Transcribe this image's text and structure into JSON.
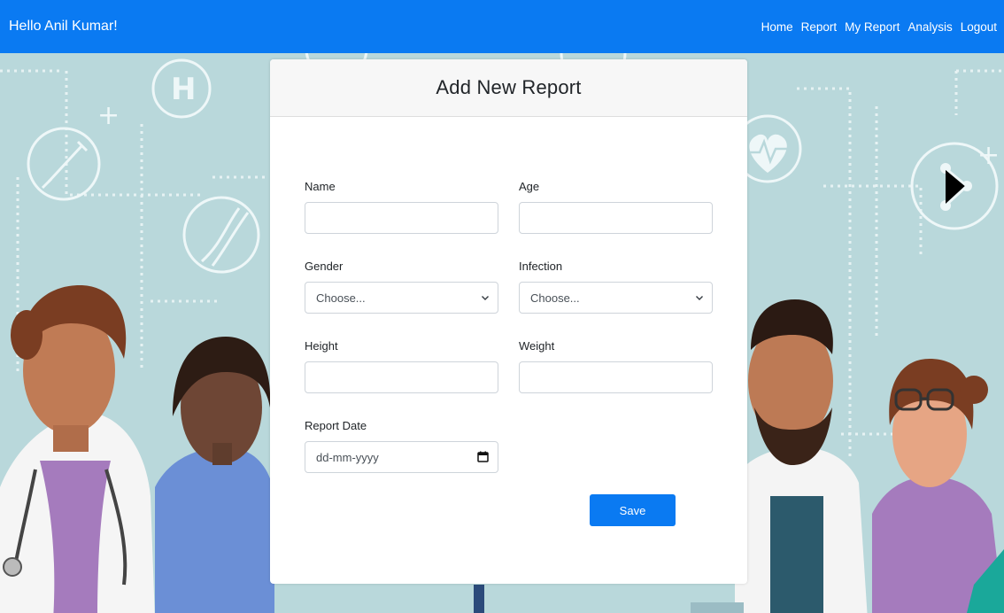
{
  "navbar": {
    "greeting": "Hello Anil Kumar!",
    "links": [
      "Home",
      "Report",
      "My Report",
      "Analysis",
      "Logout"
    ],
    "color": "#0a7af2"
  },
  "form": {
    "title": "Add New Report",
    "name": {
      "label": "Name",
      "value": ""
    },
    "age": {
      "label": "Age",
      "value": ""
    },
    "gender": {
      "label": "Gender",
      "selected": "Choose..."
    },
    "infection": {
      "label": "Infection",
      "selected": "Choose..."
    },
    "height": {
      "label": "Height",
      "value": ""
    },
    "weight": {
      "label": "Weight",
      "value": ""
    },
    "report_date": {
      "label": "Report Date",
      "placeholder": "dd-mm-yyyy"
    },
    "save_label": "Save"
  },
  "icons": {
    "chevron": "chevron-down-icon",
    "calendar": "calendar-icon"
  }
}
